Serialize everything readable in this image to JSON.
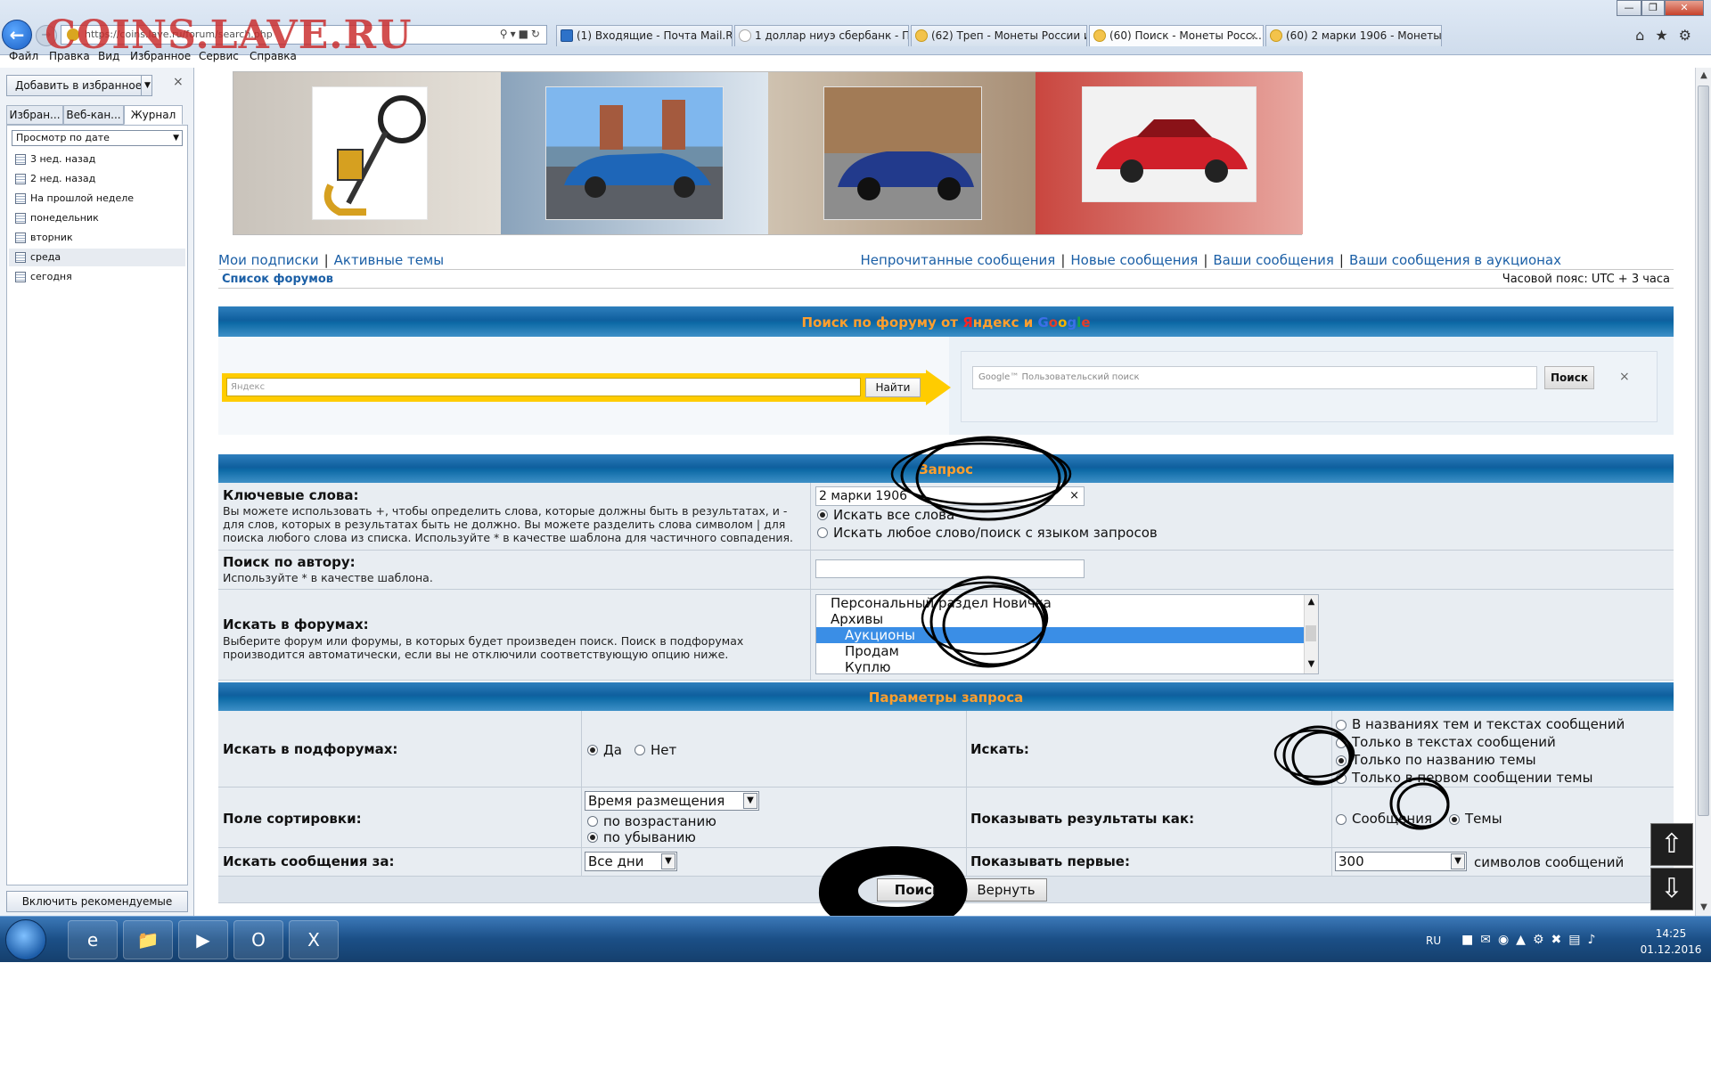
{
  "watermark": "COINS.LAVE.RU",
  "browser": {
    "address": "https://coins.lave.ru/forum/search.php",
    "tabs": [
      {
        "label": "(1) Входящие - Почта Mail.Ru",
        "icon": "mail"
      },
      {
        "label": "1 доллар ниуэ сбербанк - По...",
        "icon": "google"
      },
      {
        "label": "(62) Треп - Монеты России и ...",
        "icon": "smiley"
      },
      {
        "label": "(60) Поиск - Монеты Росс...",
        "icon": "smiley",
        "active": true
      },
      {
        "label": "(60) 2 марки 1906 - Монеты Р...",
        "icon": "smiley"
      }
    ],
    "menu": [
      "Файл",
      "Правка",
      "Вид",
      "Избранное",
      "Сервис",
      "Справка"
    ],
    "tab_close": "×"
  },
  "sidebar": {
    "add_favorites": "Добавить в избранное",
    "tabs": [
      "Избран...",
      "Веб-кан...",
      "Журнал"
    ],
    "history_view": "Просмотр по дате",
    "history": [
      "3 нед. назад",
      "2 нед. назад",
      "На прошлой неделе",
      "понедельник",
      "вторник",
      "среда",
      "сегодня"
    ],
    "suggested_sites": "Включить рекомендуемые сай...",
    "close": "×"
  },
  "nav": {
    "my_subscriptions": "Мои подписки",
    "active_topics": "Активные темы",
    "unread": "Непрочитанные сообщения",
    "new_posts": "Новые сообщения",
    "your_posts": "Ваши сообщения",
    "your_auction_posts": "Ваши сообщения в аукционах",
    "forum_list": "Список форумов",
    "timezone": "Часовой пояс: UTC + 3 часа",
    "separator": "|"
  },
  "site_search": {
    "title_prefix": "Поиск по форуму от ",
    "yandex": "Я",
    "title_middle": "ндекс и ",
    "google_letters": [
      "G",
      "o",
      "o",
      "g",
      "l",
      "e"
    ],
    "yandex_placeholder": "Яндекс",
    "yandex_button": "Найти",
    "google_placeholder": "Google™ Пользовательский поиск",
    "google_button": "Поиск",
    "google_clear": "×"
  },
  "query": {
    "header": "Запрос",
    "keywords_title": "Ключевые слова:",
    "keywords_desc": "Вы можете использовать +, чтобы определить слова, которые должны быть в результатах, и - для слов, которых в результатах быть не должно. Вы можете разделить слова символом | для поиска любого слова из списка. Используйте * в качестве шаблона для частичного совпадения.",
    "keywords_value": "2 марки 1906",
    "keywords_clear": "×",
    "opt_all_words": "Искать все слова",
    "opt_any_word": "Искать любое слово/поиск с языком запросов",
    "author_title": "Поиск по автору:",
    "author_desc": "Используйте * в качестве шаблона.",
    "author_value": "",
    "forums_title": "Искать в форумах:",
    "forums_desc": "Выберите форум или форумы, в которых будет произведен поиск. Поиск в подфорумах производится автоматически, если вы не отключили соответствующую опцию ниже.",
    "forums": [
      {
        "label": "Персональный раздел Новичка",
        "indent": false,
        "selected": false
      },
      {
        "label": "Архивы",
        "indent": false,
        "selected": false
      },
      {
        "label": "Аукционы",
        "indent": true,
        "selected": true
      },
      {
        "label": "Продам",
        "indent": true,
        "selected": false
      },
      {
        "label": "Куплю",
        "indent": true,
        "selected": false
      }
    ]
  },
  "params": {
    "header": "Параметры запроса",
    "subforums_title": "Искать в подфорумах:",
    "yes": "Да",
    "no": "Нет",
    "search_in_title": "Искать:",
    "search_in_opts": [
      "В названиях тем и текстах сообщений",
      "Только в текстах сообщений",
      "Только по названию темы",
      "Только в первом сообщении темы"
    ],
    "sort_title": "Поле сортировки:",
    "sort_field": "Время размещения",
    "asc": "по возрастанию",
    "desc": "по убыванию",
    "show_as_title": "Показывать результаты как:",
    "show_posts": "Сообщения",
    "show_topics": "Темы",
    "period_title": "Искать сообщения за:",
    "period_value": "Все дни",
    "show_first_title": "Показывать первые:",
    "show_first_value": "300",
    "chars_label": "символов сообщений",
    "submit": "Поиск",
    "reset": "Вернуть"
  },
  "taskbar": {
    "lang": "RU",
    "time": "14:25",
    "date": "01.12.2016"
  }
}
